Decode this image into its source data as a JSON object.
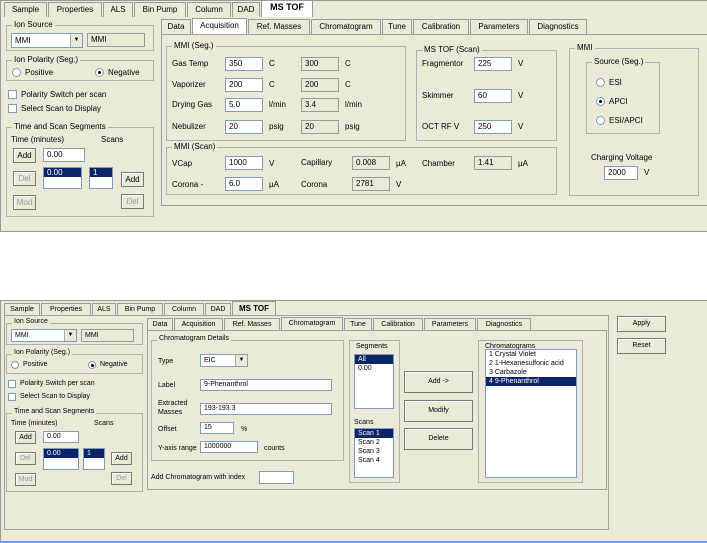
{
  "screen1": {
    "tabs": [
      "Sample",
      "Properties",
      "ALS",
      "Bin Pump",
      "Column",
      "DAD",
      "MS TOF"
    ],
    "subtabs": [
      "Data",
      "Acquisition",
      "Ref. Masses",
      "Chromatogram",
      "Tune",
      "Calibration",
      "Parameters",
      "Diagnostics"
    ],
    "left": {
      "ion_source_title": "Ion Source",
      "ion_source_value": "MMI",
      "ion_source_readout": "MMI",
      "ion_polarity_title": "Ion Polarity (Seg.)",
      "positive": "Positive",
      "negative": "Negative",
      "polarity_switch": "Polarity Switch per scan",
      "select_scan": "Select Scan to Display",
      "time_title": "Time and Scan Segments",
      "time_header": "Time (minutes)",
      "scans_header": "Scans",
      "time_value": "0.00",
      "segment_item": "0.00",
      "scan_item": "1",
      "add": "Add",
      "del": "Del",
      "mod": "Mod"
    },
    "mmi_seg": {
      "title": "MMI (Seg.)",
      "rows": [
        {
          "label": "Gas Temp",
          "value": "350",
          "unit": "C",
          "actual": "300",
          "actual_unit": "C"
        },
        {
          "label": "Vaporizer",
          "value": "200",
          "unit": "C",
          "actual": "200",
          "actual_unit": "C"
        },
        {
          "label": "Drying Gas",
          "value": "5.0",
          "unit": "l/min",
          "actual": "3.4",
          "actual_unit": "l/min"
        },
        {
          "label": "Nebulizer",
          "value": "20",
          "unit": "psig",
          "actual": "20",
          "actual_unit": "psig"
        }
      ]
    },
    "ms_tof": {
      "title": "MS TOF (Scan)",
      "rows": [
        {
          "label": "Fragmentor",
          "value": "225",
          "unit": "V"
        },
        {
          "label": "Skimmer",
          "value": "60",
          "unit": "V"
        },
        {
          "label": "OCT RF V",
          "value": "250",
          "unit": "V"
        }
      ]
    },
    "mmi_scan": {
      "title": "MMI (Scan)",
      "vcap_label": "VCap",
      "vcap_value": "1000",
      "vcap_unit": "V",
      "corona_label": "Corona -",
      "corona_value": "6.0",
      "corona_unit": "µA",
      "capillary_label": "Capillary",
      "capillary_value": "0.008",
      "capillary_unit": "µA",
      "corona_read_label": "Corona",
      "corona_read_value": "2781",
      "corona_read_unit": "V",
      "chamber_label": "Chamber",
      "chamber_value": "1.41",
      "chamber_unit": "µA"
    },
    "mmi_right": {
      "title": "MMI",
      "source_title": "Source (Seg.)",
      "options": [
        "ESI",
        "APCI",
        "ESI/APCI"
      ],
      "charging_label": "Charging Voltage",
      "charging_value": "2000",
      "charging_unit": "V"
    }
  },
  "screen2": {
    "tabs": [
      "Sample",
      "Properties",
      "ALS",
      "Bin Pump",
      "Column",
      "DAD",
      "MS TOF"
    ],
    "subtabs": [
      "Data",
      "Acquisition",
      "Ref. Masses",
      "Chromatogram",
      "Tune",
      "Calibration",
      "Parameters",
      "Diagnostics"
    ],
    "apply": "Apply",
    "reset": "Reset",
    "details": {
      "title": "Chromatogram Details",
      "type_label": "Type",
      "type_value": "EIC",
      "label_label": "Label",
      "label_value": "9-Phenanthrol",
      "extracted_label_1": "Extracted",
      "extracted_label_2": "Masses",
      "extracted_value": "193-193.3",
      "offset_label": "Offset",
      "offset_value": "15",
      "offset_unit": "%",
      "yaxis_label": "Y-axis range",
      "yaxis_value": "1000000",
      "yaxis_unit": "counts"
    },
    "add_chrom_label": "Add Chromatogram with index",
    "segments_title": "Segments",
    "segments": [
      "All",
      "0.00"
    ],
    "scans_title": "Scans",
    "scans": [
      "Scan 1",
      "Scan 2",
      "Scan 3",
      "Scan 4"
    ],
    "add_btn": "Add ->",
    "modify_btn": "Modify",
    "delete_btn": "Delete",
    "chromatograms_title": "Chromatograms",
    "chromatograms": [
      "1 Crystal Violet",
      "2 1-Hexanesulfonic acid",
      "3 Carbazole",
      "4 9-Phenanthrol"
    ]
  }
}
